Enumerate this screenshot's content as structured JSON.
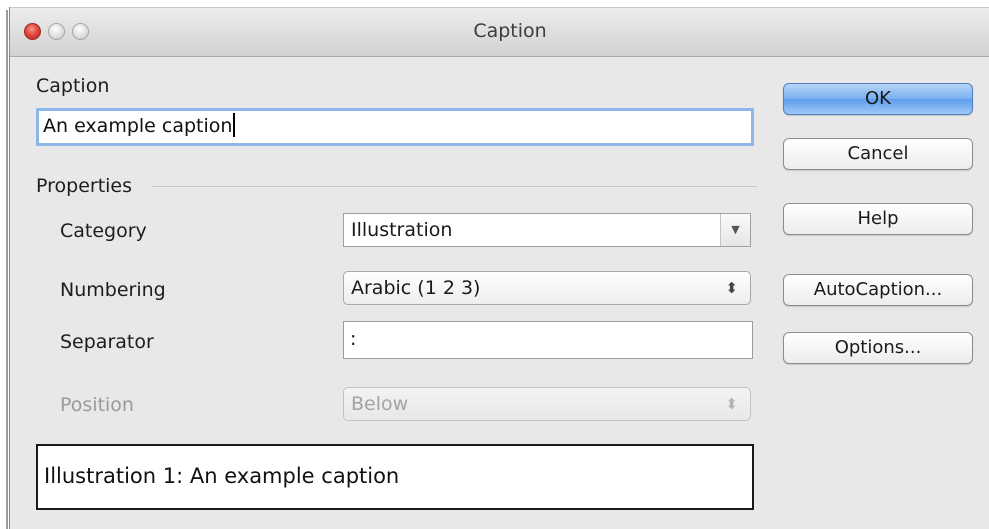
{
  "window": {
    "title": "Caption"
  },
  "caption_section": {
    "label": "Caption",
    "value": "An example caption"
  },
  "properties": {
    "heading": "Properties",
    "category": {
      "label": "Category",
      "value": "Illustration"
    },
    "numbering": {
      "label": "Numbering",
      "value": "Arabic (1 2 3)"
    },
    "separator": {
      "label": "Separator",
      "value": ":"
    },
    "position": {
      "label": "Position",
      "value": "Below",
      "enabled": false
    }
  },
  "preview": {
    "text": "Illustration 1: An example caption"
  },
  "buttons": {
    "ok": "OK",
    "cancel": "Cancel",
    "help": "Help",
    "autocaption": "AutoCaption...",
    "options": "Options..."
  },
  "colors": {
    "default_button": "#78aef0",
    "focus_ring": "#8fb6e8",
    "close_button": "#e2463b"
  }
}
